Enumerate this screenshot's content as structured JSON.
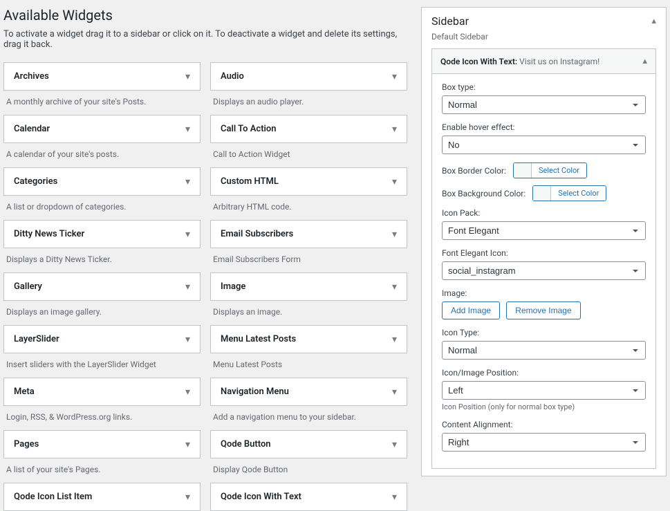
{
  "heading": "Available Widgets",
  "subheading": "To activate a widget drag it to a sidebar or click on it. To deactivate a widget and delete its settings, drag it back.",
  "widgets_left": [
    {
      "title": "Archives",
      "desc": "A monthly archive of your site's Posts."
    },
    {
      "title": "Calendar",
      "desc": "A calendar of your site's posts."
    },
    {
      "title": "Categories",
      "desc": "A list or dropdown of categories."
    },
    {
      "title": "Ditty News Ticker",
      "desc": "Displays a Ditty News Ticker."
    },
    {
      "title": "Gallery",
      "desc": "Displays an image gallery."
    },
    {
      "title": "LayerSlider",
      "desc": "Insert sliders with the LayerSlider Widget"
    },
    {
      "title": "Meta",
      "desc": "Login, RSS, & WordPress.org links."
    },
    {
      "title": "Pages",
      "desc": "A list of your site's Pages."
    },
    {
      "title": "Qode Icon List Item",
      "desc": ""
    }
  ],
  "widgets_right": [
    {
      "title": "Audio",
      "desc": "Displays an audio player."
    },
    {
      "title": "Call To Action",
      "desc": "Call to Action Widget"
    },
    {
      "title": "Custom HTML",
      "desc": "Arbitrary HTML code."
    },
    {
      "title": "Email Subscribers",
      "desc": "Email Subscribers Form"
    },
    {
      "title": "Image",
      "desc": "Displays an image."
    },
    {
      "title": "Menu Latest Posts",
      "desc": "Menu Latest Posts"
    },
    {
      "title": "Navigation Menu",
      "desc": "Add a navigation menu to your sidebar."
    },
    {
      "title": "Qode Button",
      "desc": "Display Qode Button"
    },
    {
      "title": "Qode Icon With Text",
      "desc": ""
    }
  ],
  "sidebar": {
    "title": "Sidebar",
    "subtitle": "Default Sidebar",
    "widget": {
      "name": "Qode Icon With Text:",
      "instance_title": "Visit us on Instagram!",
      "fields": {
        "box_type_label": "Box type:",
        "box_type_value": "Normal",
        "hover_label": "Enable hover effect:",
        "hover_value": "No",
        "border_color_label": "Box Border Color:",
        "bg_color_label": "Box Background Color:",
        "select_color": "Select Color",
        "icon_pack_label": "Icon Pack:",
        "icon_pack_value": "Font Elegant",
        "font_elegant_label": "Font Elegant Icon:",
        "font_elegant_value": "social_instagram",
        "image_label": "Image:",
        "add_image": "Add Image",
        "remove_image": "Remove Image",
        "icon_type_label": "Icon Type:",
        "icon_type_value": "Normal",
        "icon_position_label": "Icon/Image Position:",
        "icon_position_value": "Left",
        "icon_position_help": "Icon Position (only for normal box type)",
        "content_align_label": "Content Alignment:",
        "content_align_value": "Right"
      }
    }
  }
}
